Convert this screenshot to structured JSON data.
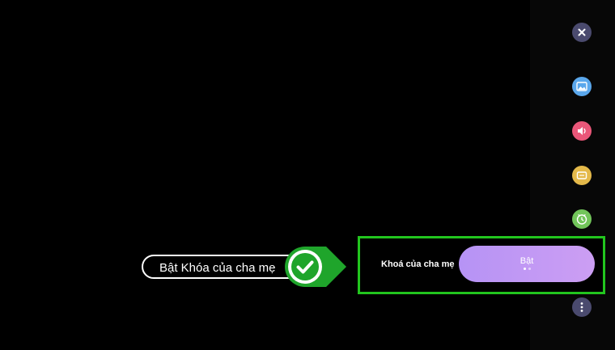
{
  "callout": {
    "text": "Bật Khóa của cha mẹ",
    "check_color": "#1fa52b"
  },
  "setting": {
    "label": "Khoá của cha mẹ",
    "value": "Bật",
    "pager_dots": 2,
    "active_dot": 1,
    "highlight_color": "#22c51e",
    "toggle_color": "#c39af4"
  },
  "sidebar": {
    "buttons": [
      {
        "icon": "close-icon",
        "color": "#4a4a6e"
      },
      {
        "icon": "picture-icon",
        "color": "#5aa7ec"
      },
      {
        "icon": "sound-icon",
        "color": "#ea5779"
      },
      {
        "icon": "screen-icon",
        "color": "#e4b94a"
      },
      {
        "icon": "timer-icon",
        "color": "#72c55a"
      },
      {
        "icon": "more-icon",
        "color": "#4a4a6e"
      }
    ]
  }
}
